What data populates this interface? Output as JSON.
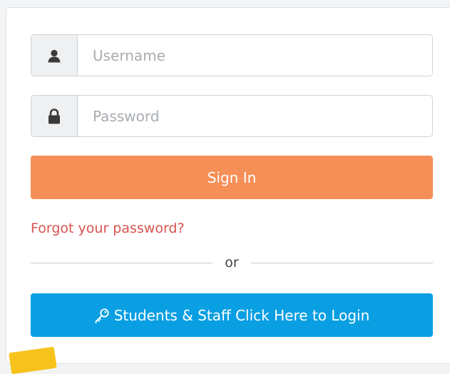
{
  "login": {
    "username_placeholder": "Username",
    "password_placeholder": "Password",
    "sign_in_label": "Sign In",
    "forgot_label": "Forgot your password?",
    "divider_label": "or",
    "sso_label": "Students & Staff Click Here to Login"
  },
  "icons": {
    "user": "user-icon",
    "lock": "lock-icon",
    "key": "key-icon"
  },
  "colors": {
    "sign_in": "#f58f57",
    "sso": "#0a9fe3",
    "forgot_link": "#d9534f",
    "sticker": "#f7c21b"
  }
}
